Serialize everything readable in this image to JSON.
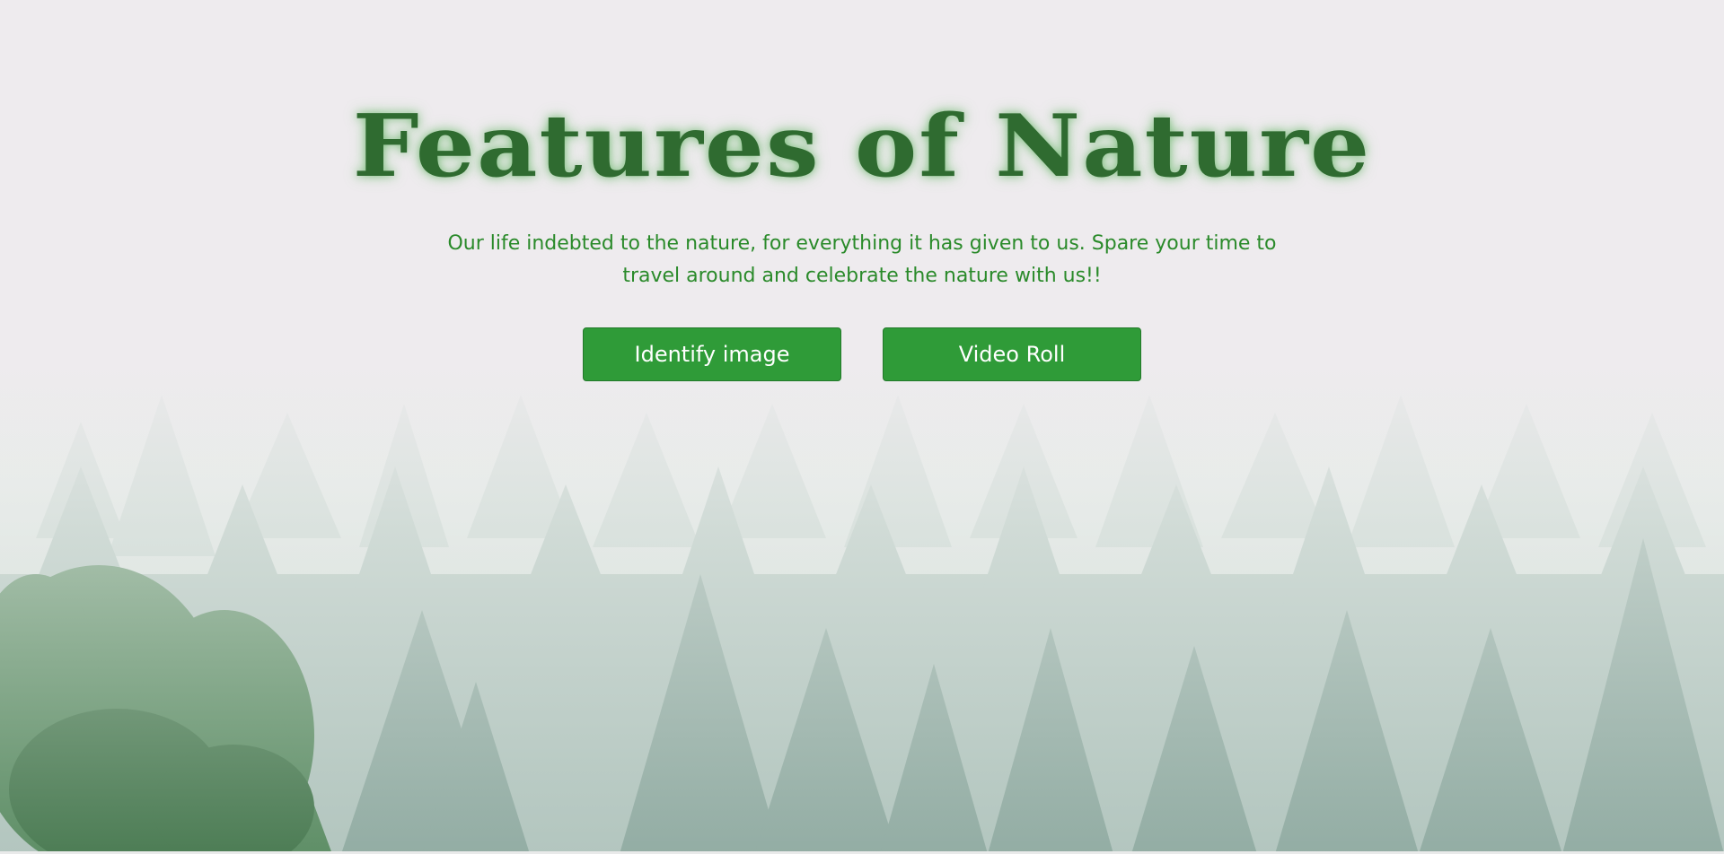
{
  "hero": {
    "title": "Features of Nature",
    "subtitle": "Our life indebted to the nature, for everything it has given to us. Spare your time to travel around and celebrate the nature with us!!"
  },
  "buttons": {
    "identify_label": "Identify image",
    "video_label": "Video Roll"
  },
  "colors": {
    "title": "#2f6b30",
    "subtitle": "#2a8a2a",
    "button_bg": "#2f9b38",
    "button_text": "#ffffff"
  }
}
